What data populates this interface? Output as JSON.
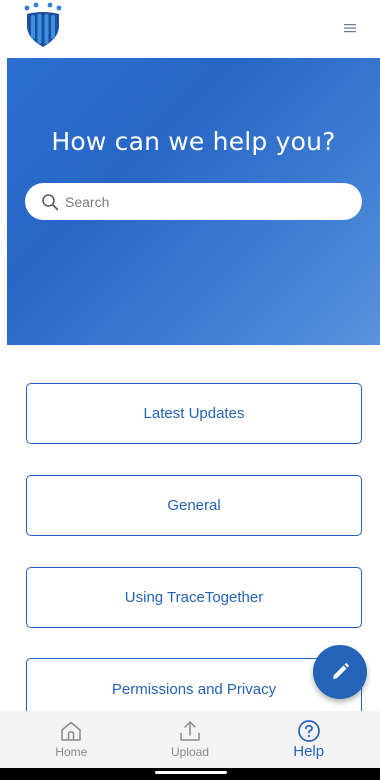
{
  "app": {
    "brand_color": "#2463b8"
  },
  "header": {
    "logo_icon": "tracetogether-logo-icon",
    "menu_icon": "hamburger-menu-icon"
  },
  "hero": {
    "title": "How can we help you?",
    "search": {
      "placeholder": "Search",
      "value": "",
      "icon": "search-icon"
    }
  },
  "categories": [
    {
      "label": "Latest Updates"
    },
    {
      "label": "General"
    },
    {
      "label": "Using TraceTogether"
    },
    {
      "label": "Permissions and Privacy"
    }
  ],
  "fab": {
    "icon": "pencil-icon"
  },
  "bottom_nav": {
    "items": [
      {
        "label": "Home",
        "icon": "home-icon",
        "active": false
      },
      {
        "label": "Upload",
        "icon": "upload-icon",
        "active": false
      },
      {
        "label": "Help",
        "icon": "help-circle-icon",
        "active": true
      }
    ]
  }
}
